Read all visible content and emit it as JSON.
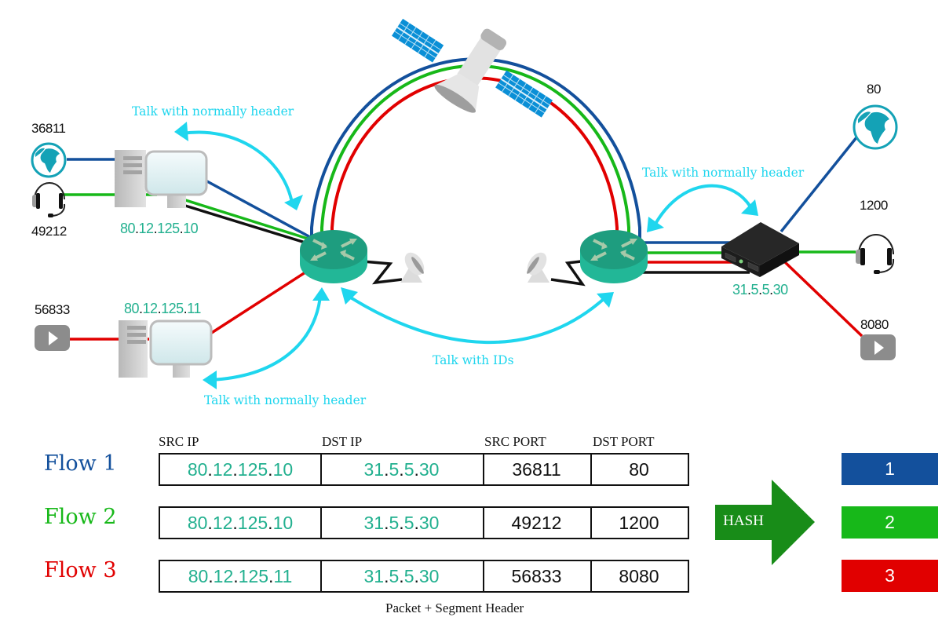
{
  "colors": {
    "flow1": "#13509c",
    "flow2": "#17b819",
    "flow3": "#e10000",
    "talk": "#1fd6ee",
    "ip": "#22b08f",
    "router": "#22b797",
    "hash": "#188c18"
  },
  "left_hosts": [
    {
      "id": "host-a",
      "ip": [
        "80",
        "12",
        "125",
        "10"
      ],
      "apps": [
        {
          "icon": "globe-icon",
          "port": "36811",
          "flow": 1
        },
        {
          "icon": "headset-icon",
          "port": "49212",
          "flow": 2
        }
      ]
    },
    {
      "id": "host-b",
      "ip": [
        "80",
        "12",
        "125",
        "11"
      ],
      "apps": [
        {
          "icon": "video-play-icon",
          "port": "56833",
          "flow": 3
        }
      ]
    }
  ],
  "right_host": {
    "ip": [
      "31",
      "5",
      "5",
      "30"
    ],
    "apps": [
      {
        "icon": "globe-icon",
        "port": "80",
        "flow": 1
      },
      {
        "icon": "headset-icon",
        "port": "1200",
        "flow": 2
      },
      {
        "icon": "video-play-icon",
        "port": "8080",
        "flow": 3
      }
    ]
  },
  "annotations": {
    "left_top": "Talk with normally header",
    "left_bottom": "Talk with normally header",
    "right_top": "Talk with normally header",
    "middle": "Talk with IDs"
  },
  "table": {
    "headers": [
      "SRC IP",
      "DST IP",
      "SRC PORT",
      "DST PORT"
    ],
    "rows": [
      {
        "label": "Flow 1",
        "src_ip": [
          "80",
          "12",
          "125",
          "10"
        ],
        "dst_ip": [
          "31",
          "5",
          "5",
          "30"
        ],
        "src_port": "36811",
        "dst_port": "80"
      },
      {
        "label": "Flow 2",
        "src_ip": [
          "80",
          "12",
          "125",
          "10"
        ],
        "dst_ip": [
          "31",
          "5",
          "5",
          "30"
        ],
        "src_port": "49212",
        "dst_port": "1200"
      },
      {
        "label": "Flow 3",
        "src_ip": [
          "80",
          "12",
          "125",
          "11"
        ],
        "dst_ip": [
          "31",
          "5",
          "5",
          "30"
        ],
        "src_port": "56833",
        "dst_port": "8080"
      }
    ],
    "caption": "Packet + Segment Header"
  },
  "hash": {
    "label": "HASH",
    "buckets": [
      "1",
      "2",
      "3"
    ]
  }
}
